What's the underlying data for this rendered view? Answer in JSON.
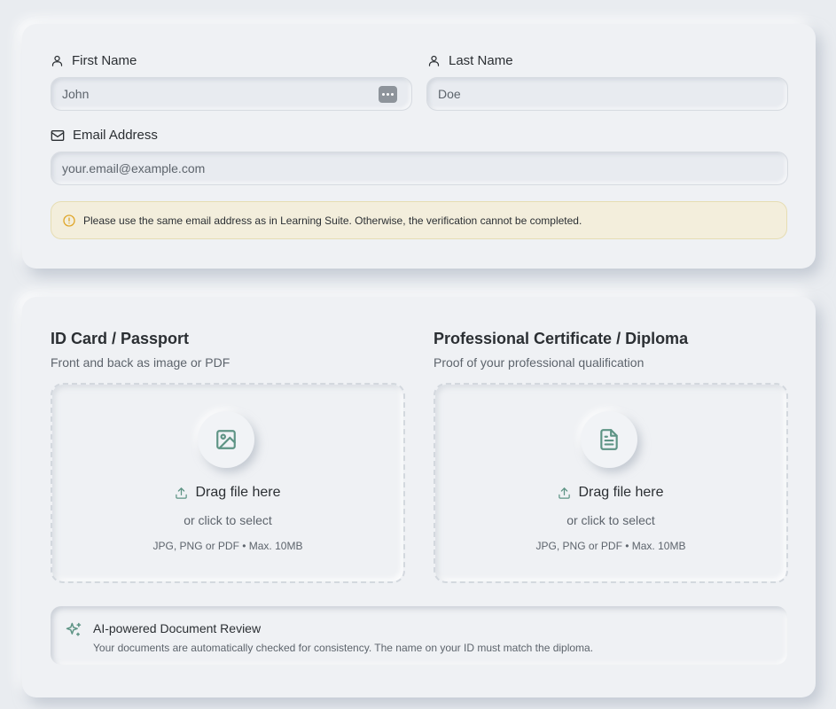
{
  "personal": {
    "first_name": {
      "label": "First Name",
      "value": "John"
    },
    "last_name": {
      "label": "Last Name",
      "value": "Doe"
    },
    "email": {
      "label": "Email Address",
      "placeholder": "your.email@example.com"
    },
    "notice": "Please use the same email address as in Learning Suite. Otherwise, the verification cannot be completed."
  },
  "documents": {
    "id_card": {
      "title": "ID Card / Passport",
      "subtitle": "Front and back as image or PDF",
      "drop_label": "Drag file here",
      "drop_or": "or click to select",
      "drop_hint": "JPG, PNG or PDF • Max. 10MB"
    },
    "certificate": {
      "title": "Professional Certificate / Diploma",
      "subtitle": "Proof of your professional qualification",
      "drop_label": "Drag file here",
      "drop_or": "or click to select",
      "drop_hint": "JPG, PNG or PDF • Max. 10MB"
    },
    "ai_review": {
      "title": "AI-powered Document Review",
      "text": "Your documents are automatically checked for consistency. The name on your ID must match the diploma."
    }
  },
  "colors": {
    "accent": "#5e9485",
    "notice_bg": "#f3eedc",
    "warning_icon": "#e0a72c"
  },
  "icons": {
    "first_name": "user-icon",
    "last_name": "user-icon",
    "email": "mail-icon",
    "notice": "alert-circle-icon",
    "id_card": "image-icon",
    "certificate": "file-text-icon",
    "upload": "upload-icon",
    "ai": "sparkles-icon"
  }
}
